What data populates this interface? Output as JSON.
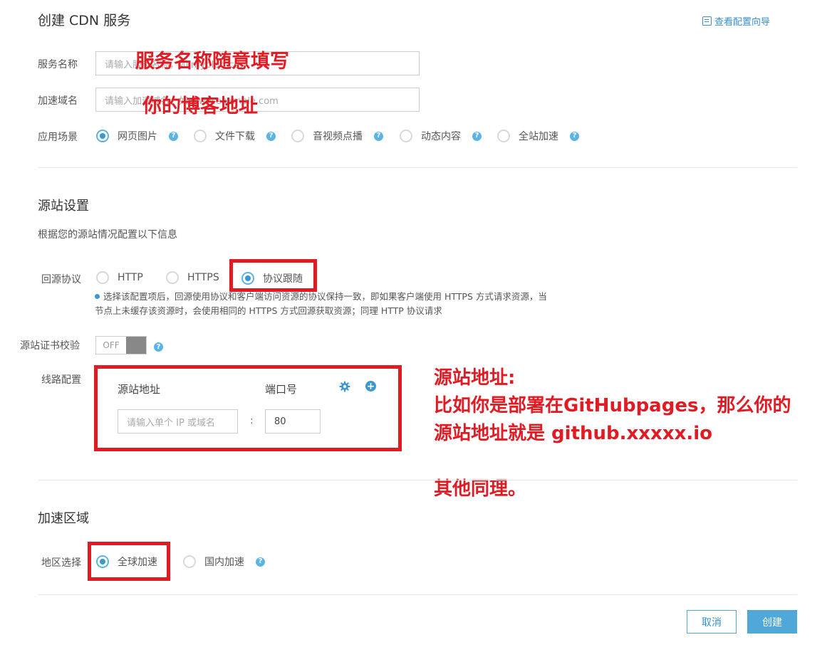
{
  "header": {
    "title": "创建 CDN 服务",
    "guide_link": "查看配置向导"
  },
  "form": {
    "service_name_label": "服务名称",
    "service_name_placeholder": "请输入服务名称，如 myblog-cdn",
    "domain_label": "加速域名",
    "domain_placeholder": "请输入加速域名，如 www.example.com",
    "scene_label": "应用场景",
    "scenes": [
      {
        "label": "网页图片",
        "selected": true
      },
      {
        "label": "文件下载",
        "selected": false
      },
      {
        "label": "音视频点播",
        "selected": false
      },
      {
        "label": "动态内容",
        "selected": false
      },
      {
        "label": "全站加速",
        "selected": false
      }
    ]
  },
  "origin": {
    "section_title": "源站设置",
    "subtitle": "根据您的源站情况配置以下信息",
    "protocol_label": "回源协议",
    "protocols": [
      {
        "label": "HTTP",
        "selected": false
      },
      {
        "label": "HTTPS",
        "selected": false
      },
      {
        "label": "协议跟随",
        "selected": true
      }
    ],
    "protocol_note_line1": "选择该配置项后，回源使用协议和客户端访问资源的协议保持一致，即如果客户端使用 HTTPS 方式请求资源，当",
    "protocol_note_line2": "节点上未缓存该资源时，会使用相同的 HTTPS 方式回源获取资源；同理 HTTP 协议请求",
    "cert_label": "源站证书校验",
    "cert_toggle": "OFF",
    "route_label": "线路配置",
    "col_address": "源站地址",
    "col_port": "端口号",
    "address_placeholder": "请输入单个 IP 或域名",
    "port_separator": ":",
    "port_value": "80"
  },
  "region": {
    "section_title": "加速区域",
    "label": "地区选择",
    "options": [
      {
        "label": "全球加速",
        "selected": true
      },
      {
        "label": "国内加速",
        "selected": false
      }
    ]
  },
  "footer": {
    "cancel": "取消",
    "create": "创建"
  },
  "annotations": {
    "name_hint": "服务名称随意填写",
    "domain_hint": "你的博客地址",
    "origin_hint_1": "源站地址:",
    "origin_hint_2": "比如你是部署在GitHubpages，那么你的",
    "origin_hint_3": "源站地址就是 github.xxxxx.io",
    "origin_hint_4": "其他同理。"
  },
  "colors": {
    "accent": "#3a97d6",
    "annotation_red": "#e01b24"
  }
}
